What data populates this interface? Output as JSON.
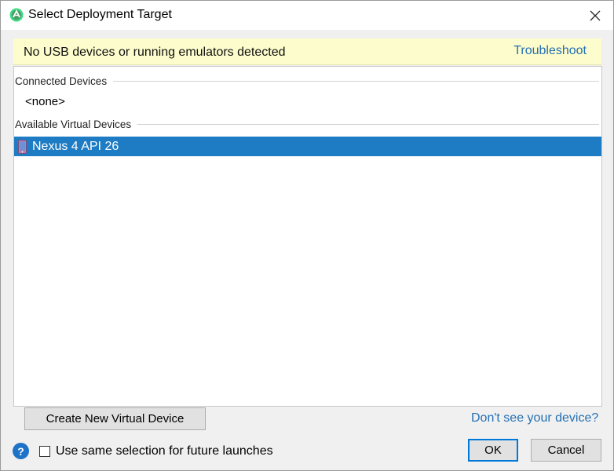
{
  "window": {
    "title": "Select Deployment Target",
    "close_glyph": "✕"
  },
  "banner": {
    "message": "No USB devices or running emulators detected",
    "link": "Troubleshoot",
    "background": "#fdfccc"
  },
  "devices": {
    "connected_header": "Connected Devices",
    "connected_items": [
      "<none>"
    ],
    "virtual_header": "Available Virtual Devices",
    "virtual_items": [
      {
        "label": "Nexus 4 API 26",
        "selected": true,
        "icon": "phone-icon"
      }
    ]
  },
  "actions": {
    "create_button": "Create New Virtual Device",
    "help_link": "Don't see your device?",
    "help_glyph": "?",
    "remember_checkbox_label": "Use same selection for future launches",
    "remember_checked": false,
    "ok_button": "OK",
    "cancel_button": "Cancel"
  },
  "colors": {
    "accent": "#0078d7",
    "selection": "#1e7cc4",
    "link": "#2470b3"
  }
}
